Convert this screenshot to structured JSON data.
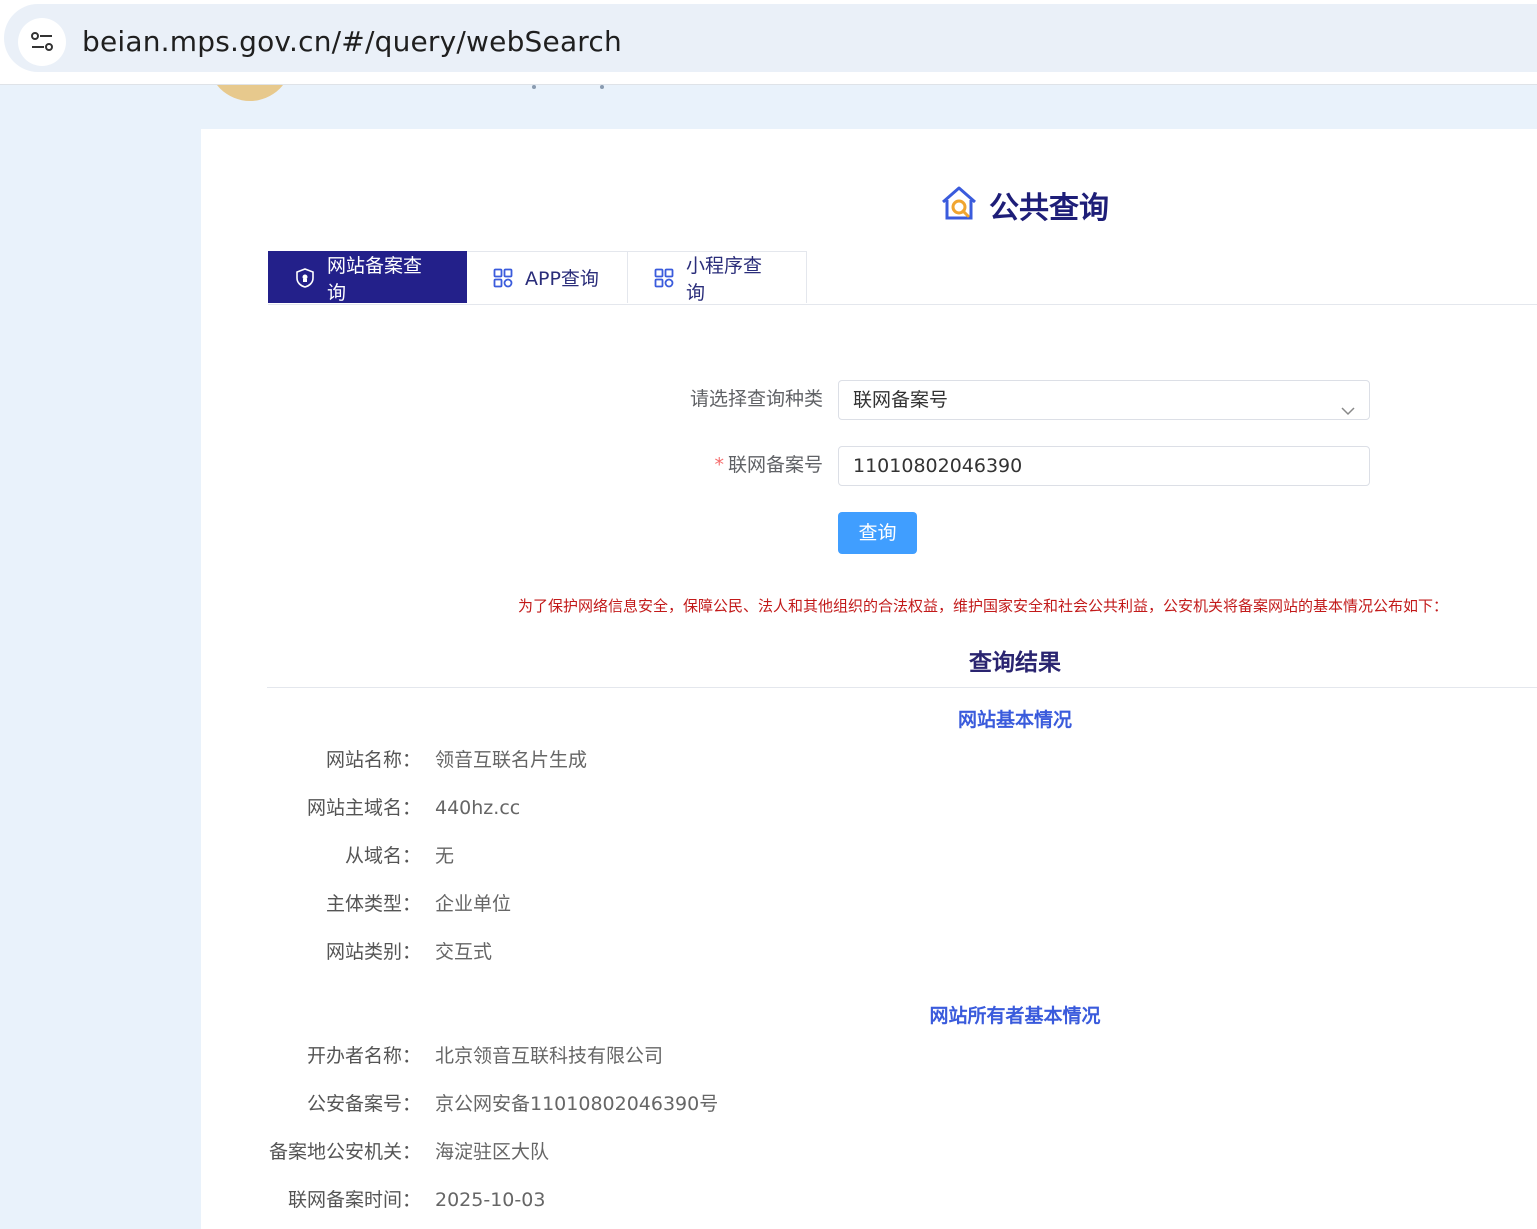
{
  "browser": {
    "url": "beian.mps.gov.cn/#/query/webSearch"
  },
  "page": {
    "title": "公共查询"
  },
  "tabs": [
    {
      "label": "网站备案查询",
      "active": true
    },
    {
      "label": "APP查询",
      "active": false
    },
    {
      "label": "小程序查询",
      "active": false
    }
  ],
  "form": {
    "type_label": "请选择查询种类",
    "type_value": "联网备案号",
    "number_label": "联网备案号",
    "required_mark": "*",
    "number_value": "11010802046390",
    "submit_label": "查询"
  },
  "notice": "为了保护网络信息安全，保障公民、法人和其他组织的合法权益，维护国家安全和社会公共利益，公安机关将备案网站的基本情况公布如下：",
  "result": {
    "title": "查询结果",
    "basic": {
      "title": "网站基本情况",
      "rows": [
        {
          "label": "网站名称：",
          "value": "领音互联名片生成"
        },
        {
          "label": "网站主域名：",
          "value": "440hz.cc"
        },
        {
          "label": "从域名：",
          "value": "无"
        },
        {
          "label": "主体类型：",
          "value": "企业单位"
        },
        {
          "label": "网站类别：",
          "value": "交互式"
        }
      ]
    },
    "owner": {
      "title": "网站所有者基本情况",
      "rows": [
        {
          "label": "开办者名称：",
          "value": "北京领音互联科技有限公司"
        },
        {
          "label": "公安备案号：",
          "value": "京公网安备11010802046390号"
        },
        {
          "label": "备案地公安机关：",
          "value": "海淀驻区大队"
        },
        {
          "label": "联网备案时间：",
          "value": "2025-10-03"
        }
      ]
    }
  },
  "colors": {
    "tab_active_bg": "#23208a",
    "button_bg": "#409eff",
    "notice_text": "#c21a1a",
    "section_title": "#3a5bdc"
  }
}
